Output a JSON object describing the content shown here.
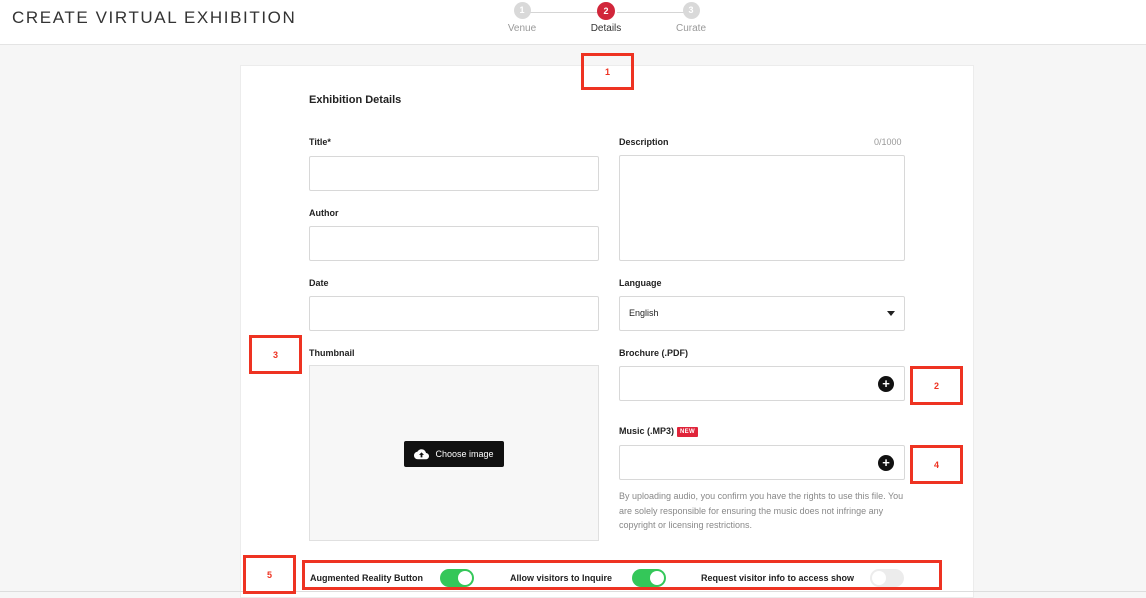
{
  "header": {
    "title": "CREATE VIRTUAL EXHIBITION"
  },
  "stepper": {
    "steps": [
      {
        "number": "1",
        "label": "Venue"
      },
      {
        "number": "2",
        "label": "Details"
      },
      {
        "number": "3",
        "label": "Curate"
      }
    ]
  },
  "form": {
    "section_title": "Exhibition Details",
    "title_label": "Title*",
    "title_value": "",
    "author_label": "Author",
    "author_value": "",
    "date_label": "Date",
    "date_value": "",
    "description_label": "Description",
    "description_value": "",
    "description_counter": "0/1000",
    "language_label": "Language",
    "language_value": "English",
    "thumbnail_label": "Thumbnail",
    "choose_image_label": "Choose image",
    "brochure_label": "Brochure (.PDF)",
    "music_label": "Music (.MP3)",
    "new_badge": "NEW",
    "music_disclaimer": "By uploading audio, you confirm you have the rights to use this file. You are solely responsible for ensuring the music does not infringe any copyright or licensing restrictions."
  },
  "toggles": {
    "ar_label": "Augmented Reality Button",
    "ar_on": true,
    "inquire_label": "Allow visitors to Inquire",
    "inquire_on": true,
    "visitor_info_label": "Request visitor info to access show",
    "visitor_info_on": false
  },
  "annotations": [
    "1",
    "2",
    "3",
    "4",
    "5"
  ],
  "colors": {
    "accent": "#d1263a",
    "toggle_on": "#34c759",
    "annotation": "#ee3322"
  }
}
